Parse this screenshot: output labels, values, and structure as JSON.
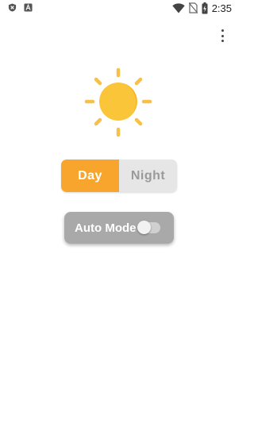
{
  "status_bar": {
    "time": "2:35",
    "left_icons": [
      "shield-notification-icon",
      "a-notification-icon"
    ],
    "right_icons": [
      "wifi-icon",
      "no-sim-icon",
      "battery-charging-icon"
    ]
  },
  "menu": {
    "icon": "overflow-menu-icon"
  },
  "sun": {
    "icon": "sun-icon",
    "color": "#fbc53a",
    "ray_color": "#f7c04a"
  },
  "theme_selector": {
    "day_label": "Day",
    "night_label": "Night",
    "selected": "Day",
    "active_color": "#f7a52c",
    "inactive_color": "#e6e6e6"
  },
  "auto_mode": {
    "label": "Auto Mode",
    "enabled": false
  }
}
